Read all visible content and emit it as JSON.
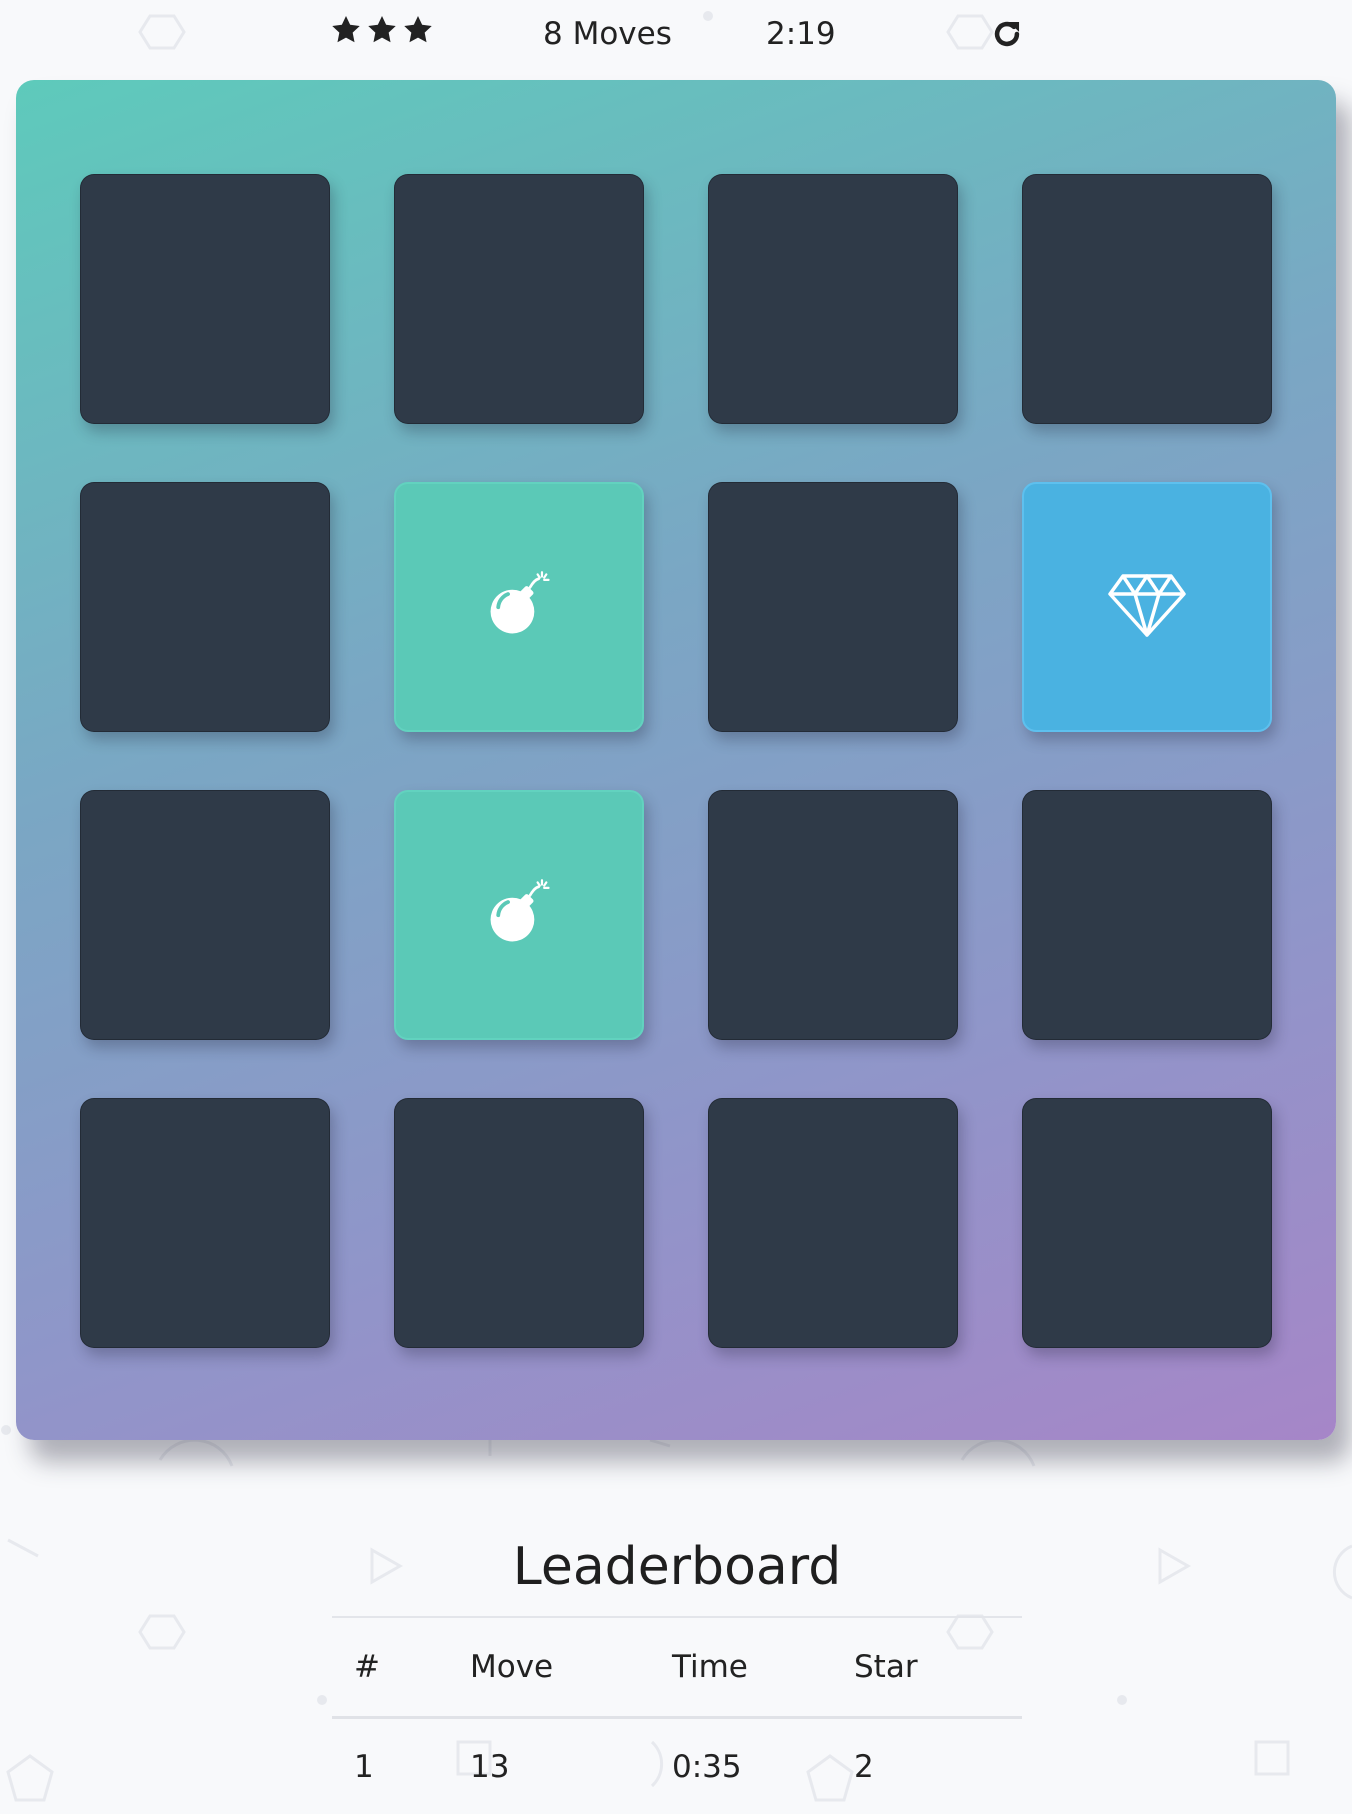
{
  "score_panel": {
    "stars": [
      {
        "icon": "star-icon"
      },
      {
        "icon": "star-icon"
      },
      {
        "icon": "star-icon"
      }
    ],
    "star_count": 3,
    "moves_text": "8 Moves",
    "timer": "2:19",
    "restart_icon": "restart-icon"
  },
  "board": {
    "cards": [
      {
        "state": "closed",
        "icon": null
      },
      {
        "state": "closed",
        "icon": null
      },
      {
        "state": "closed",
        "icon": null
      },
      {
        "state": "closed",
        "icon": null
      },
      {
        "state": "closed",
        "icon": null
      },
      {
        "state": "match",
        "icon": "bomb-icon"
      },
      {
        "state": "closed",
        "icon": null
      },
      {
        "state": "show",
        "icon": "diamond-icon"
      },
      {
        "state": "closed",
        "icon": null
      },
      {
        "state": "match",
        "icon": "bomb-icon"
      },
      {
        "state": "closed",
        "icon": null
      },
      {
        "state": "closed",
        "icon": null
      },
      {
        "state": "closed",
        "icon": null
      },
      {
        "state": "closed",
        "icon": null
      },
      {
        "state": "closed",
        "icon": null
      },
      {
        "state": "closed",
        "icon": null
      }
    ],
    "colors": {
      "closed": "#2f3a48",
      "match": "#5bc9b7",
      "show": "#4ab2e1"
    }
  },
  "leaderboard": {
    "title": "Leaderboard",
    "headers": [
      "#",
      "Move",
      "Time",
      "Star"
    ],
    "rows": [
      [
        "1",
        "13",
        "0:35",
        "2"
      ]
    ]
  }
}
